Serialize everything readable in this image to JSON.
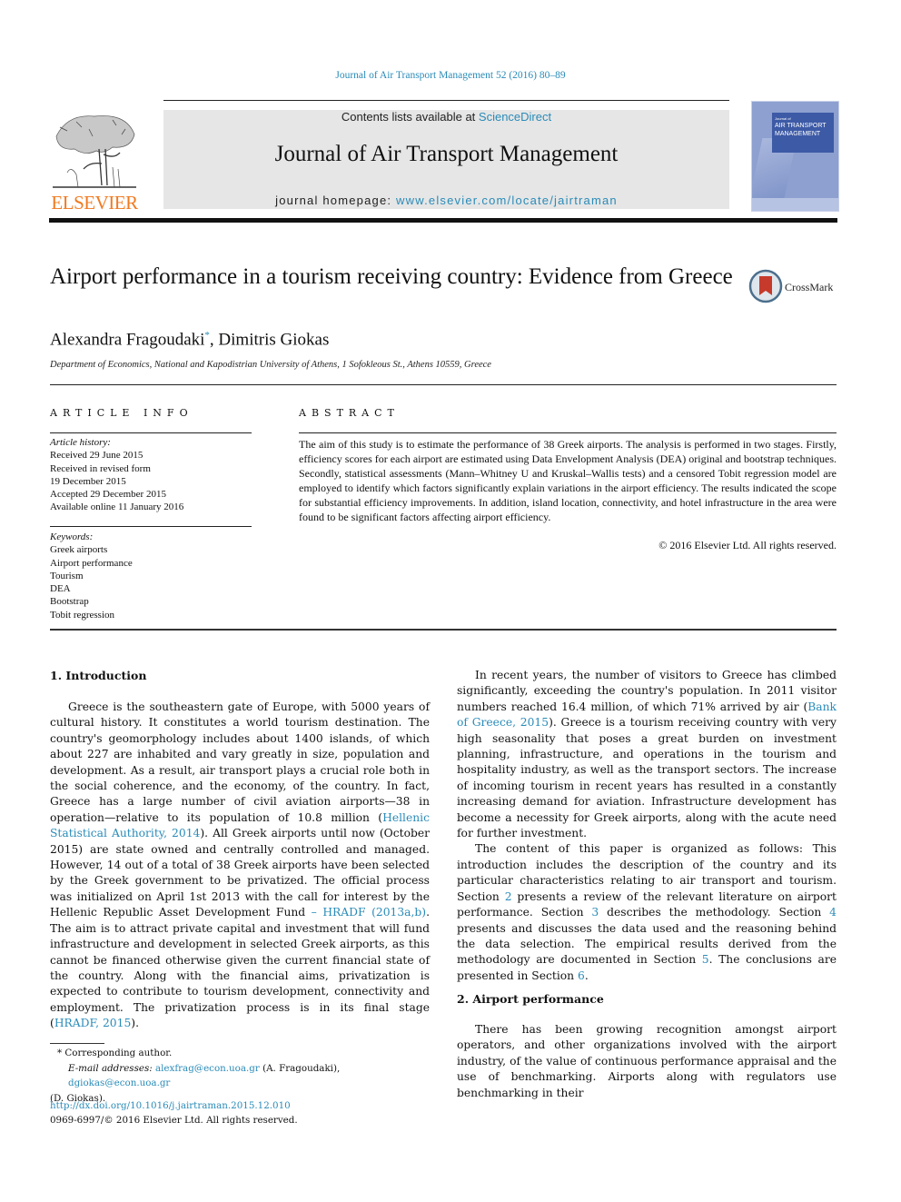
{
  "running_head": "Journal of Air Transport Management 52 (2016) 80–89",
  "masthead": {
    "contents_prefix": "Contents lists available at ",
    "contents_link": "ScienceDirect",
    "journal_title": "Journal of Air Transport Management",
    "homepage_prefix": "journal homepage: ",
    "homepage_link": "www.elsevier.com/locate/jairtraman",
    "publisher_logo_text": "ELSEVIER",
    "cover_small": "Journal of",
    "cover_line1": "AIR TRANSPORT",
    "cover_line2": "MANAGEMENT"
  },
  "article": {
    "title": "Airport performance in a tourism receiving country: Evidence from Greece",
    "crossmark_label": "CrossMark",
    "author1": "Alexandra Fragoudaki",
    "author1_mark": "*",
    "author_sep": ", ",
    "author2": "Dimitris Giokas",
    "affiliation": "Department of Economics, National and Kapodistrian University of Athens, 1 Sofokleous St., Athens 10559, Greece"
  },
  "article_info": {
    "heading": "ARTICLE INFO",
    "history_label": "Article history:",
    "history": [
      "Received 29 June 2015",
      "Received in revised form",
      "19 December 2015",
      "Accepted 29 December 2015",
      "Available online 11 January 2016"
    ],
    "keywords_label": "Keywords:",
    "keywords": [
      "Greek airports",
      "Airport performance",
      "Tourism",
      "DEA",
      "Bootstrap",
      "Tobit regression"
    ]
  },
  "abstract": {
    "heading": "ABSTRACT",
    "text": "The aim of this study is to estimate the performance of 38 Greek airports. The analysis is performed in two stages. Firstly, efficiency scores for each airport are estimated using Data Envelopment Analysis (DEA) original and bootstrap techniques. Secondly, statistical assessments (Mann–Whitney U and Kruskal–Wallis tests) and a censored Tobit regression model are employed to identify which factors significantly explain variations in the airport efficiency. The results indicated the scope for substantial efficiency improvements. In addition, island location, connectivity, and hotel infrastructure in the area were found to be significant factors affecting airport efficiency.",
    "copyright": "© 2016 Elsevier Ltd. All rights reserved."
  },
  "body": {
    "sec1_heading": "1.  Introduction",
    "p1_a": "Greece is the southeastern gate of Europe, with 5000 years of cultural history. It constitutes a world tourism destination. The country's geomorphology includes about 1400 islands, of which about 227 are inhabited and vary greatly in size, population and development. As a result, air transport plays a crucial role both in the social coherence, and the economy, of the country. In fact, Greece has a large number of civil aviation airports—38 in operation—relative to its population of 10.8 million (",
    "p1_link1": "Hellenic Statistical Authority, 2014",
    "p1_b": "). All Greek airports until now (October 2015) are state owned and centrally controlled and managed. However, 14 out of a total of 38 Greek airports have been selected by the Greek government to be privatized. The official process was initialized on April 1st 2013 with the call for interest by the Hellenic Republic Asset Development Fund ",
    "p1_link2": "– HRADF (2013a,b)",
    "p1_c": ". The aim is to attract private capital and investment that will fund infrastructure and development in selected Greek airports, as this cannot be financed otherwise given the current financial state of the country. Along with the financial aims, privatization is expected to contribute to tourism development, connectivity and employment. The privatization process is in its final stage (",
    "p1_link3": "HRADF, 2015",
    "p1_d": ").",
    "p2_a": "In recent years, the number of visitors to Greece has climbed significantly, exceeding the country's population. In 2011 visitor numbers reached 16.4 million, of which 71% arrived by air (",
    "p2_link1": "Bank of Greece, 2015",
    "p2_b": "). Greece is a tourism receiving country with very high seasonality that poses a great burden on investment planning, infrastructure, and operations in the tourism and hospitality industry, as well as the transport sectors. The increase of incoming tourism in recent years has resulted in a constantly increasing demand for aviation. Infrastructure development has become a necessity for Greek airports, along with the acute need for further investment.",
    "p3_a": "The content of this paper is organized as follows: This introduction includes the description of the country and its particular characteristics relating to air transport and tourism. Section ",
    "p3_s2": "2",
    "p3_b": " presents a review of the relevant literature on airport performance. Section ",
    "p3_s3": "3",
    "p3_c": " describes the methodology. Section ",
    "p3_s4": "4",
    "p3_d": " presents and discusses the data used and the reasoning behind the data selection. The empirical results derived from the methodology are documented in Section ",
    "p3_s5": "5",
    "p3_e": ". The conclusions are presented in Section ",
    "p3_s6": "6",
    "p3_f": ".",
    "sec2_heading": "2.  Airport performance",
    "p4": "There has been growing recognition amongst airport operators, and other organizations involved with the airport industry, of the value of continuous performance appraisal and the use of benchmarking. Airports along with regulators use benchmarking in their"
  },
  "footnotes": {
    "corresponding": "* Corresponding author.",
    "email_label": "E-mail addresses:",
    "email1": "alexfrag@econ.uoa.gr",
    "email1_name": " (A. Fragoudaki), ",
    "email2": "dgiokas@econ.uoa.gr",
    "email2_name": " (D. Giokas).",
    "doi_link": "http://dx.doi.org/10.1016/j.jairtraman.2015.12.010",
    "issn_line": "0969-6997/© 2016 Elsevier Ltd. All rights reserved."
  },
  "colors": {
    "link": "#2a8bb8",
    "elsevier_orange": "#f07a20",
    "masthead_gray": "#e6e6e6",
    "cover_blue": "#3d5aa6"
  }
}
